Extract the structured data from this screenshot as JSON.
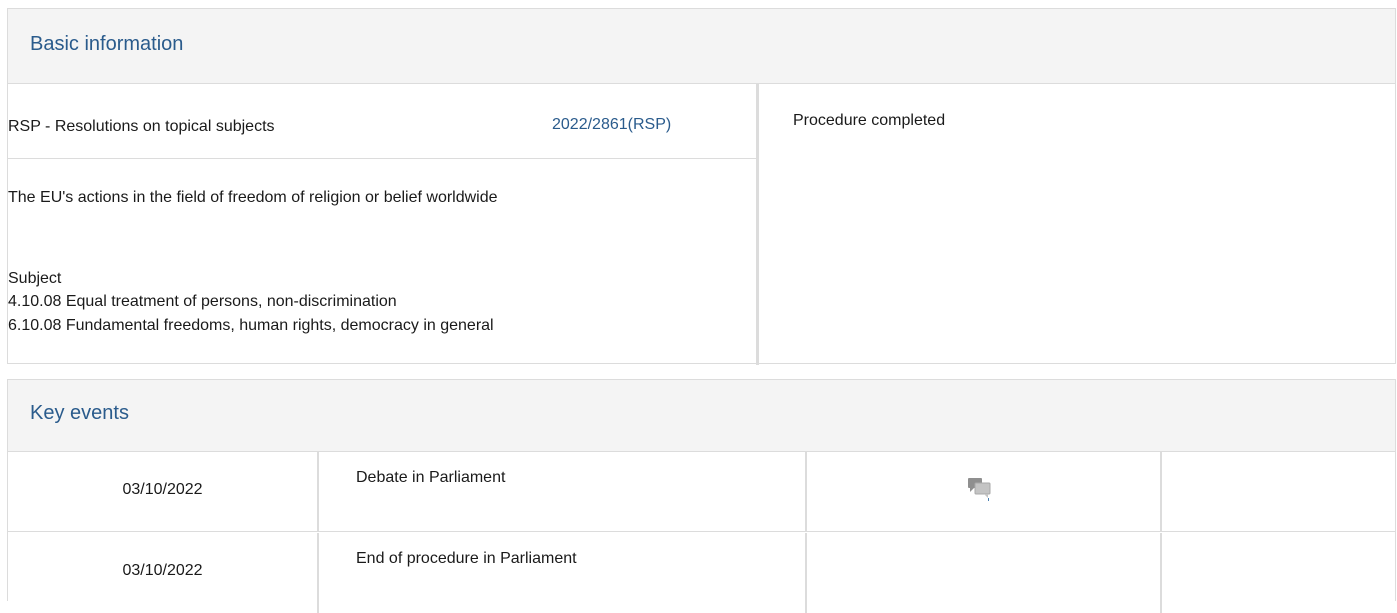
{
  "basic_information": {
    "title": "Basic information",
    "procedure_type": "RSP - Resolutions on topical subjects",
    "procedure_reference": "2022/2861(RSP)",
    "status": "Procedure completed",
    "procedure_title": "The EU's actions in the field of freedom of religion or belief worldwide",
    "subject_label": "Subject",
    "subjects": [
      "4.10.08 Equal treatment of persons, non-discrimination",
      "6.10.08 Fundamental freedoms, human rights, democracy in general"
    ]
  },
  "key_events": {
    "title": "Key events",
    "rows": [
      {
        "date": "03/10/2022",
        "event": "Debate in Parliament",
        "icon": "debate-icon"
      },
      {
        "date": "03/10/2022",
        "event": "End of procedure in Parliament",
        "icon": ""
      }
    ]
  }
}
